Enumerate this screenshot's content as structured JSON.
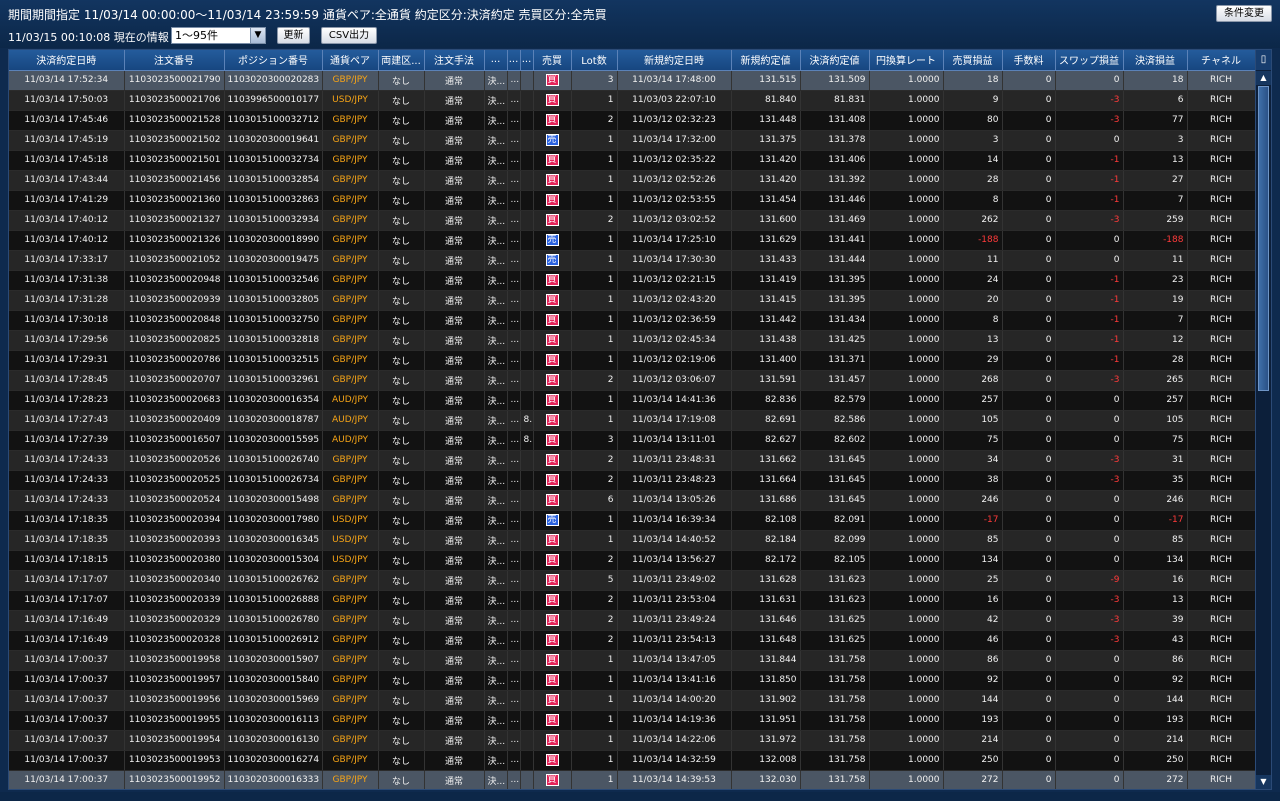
{
  "header": {
    "line1": "期間期間指定  11/03/14 00:00:00～11/03/14 23:59:59   通貨ペア:全通貨   約定区分:決済約定   売買区分:全売買",
    "line2": "11/03/15 00:10:08  現在の情報",
    "range_value": "1～95件",
    "update_label": "更新",
    "csv_label": "CSV出力",
    "condition_label": "条件変更"
  },
  "columns": [
    "決済約定日時",
    "注文番号",
    "ポジション番号",
    "通貨ペア",
    "両建区...",
    "注文手法",
    "...",
    "...",
    "...",
    "売買",
    "Lot数",
    "新規約定日時",
    "新規約定値",
    "決済約定値",
    "円換算レート",
    "売買損益",
    "手数料",
    "スワップ損益",
    "決済損益",
    "チャネル"
  ],
  "colors": {
    "buy": "#e4245a",
    "sell": "#2a62e0",
    "pair": "#f6a417",
    "negative": "#ff3a3a"
  },
  "rows": [
    [
      "11/03/14 17:52:34",
      "1103023500021790",
      "1103020300020283",
      "GBP/JPY",
      "なし",
      "通常",
      "決...",
      "...",
      "",
      "買",
      "3",
      "11/03/14 17:48:00",
      "131.515",
      "131.509",
      "1.0000",
      "18",
      "0",
      "0",
      "18",
      "RICH"
    ],
    [
      "11/03/14 17:50:03",
      "1103023500021706",
      "1103996500010177",
      "USD/JPY",
      "なし",
      "通常",
      "決...",
      "...",
      "",
      "買",
      "1",
      "11/03/03 22:07:10",
      "81.840",
      "81.831",
      "1.0000",
      "9",
      "0",
      "-3",
      "6",
      "RICH"
    ],
    [
      "11/03/14 17:45:46",
      "1103023500021528",
      "1103015100032712",
      "GBP/JPY",
      "なし",
      "通常",
      "決...",
      "...",
      "",
      "買",
      "2",
      "11/03/12 02:32:23",
      "131.448",
      "131.408",
      "1.0000",
      "80",
      "0",
      "-3",
      "77",
      "RICH"
    ],
    [
      "11/03/14 17:45:19",
      "1103023500021502",
      "1103020300019641",
      "GBP/JPY",
      "なし",
      "通常",
      "決...",
      "...",
      "",
      "売",
      "1",
      "11/03/14 17:32:00",
      "131.375",
      "131.378",
      "1.0000",
      "3",
      "0",
      "0",
      "3",
      "RICH"
    ],
    [
      "11/03/14 17:45:18",
      "1103023500021501",
      "1103015100032734",
      "GBP/JPY",
      "なし",
      "通常",
      "決...",
      "...",
      "",
      "買",
      "1",
      "11/03/12 02:35:22",
      "131.420",
      "131.406",
      "1.0000",
      "14",
      "0",
      "-1",
      "13",
      "RICH"
    ],
    [
      "11/03/14 17:43:44",
      "1103023500021456",
      "1103015100032854",
      "GBP/JPY",
      "なし",
      "通常",
      "決...",
      "...",
      "",
      "買",
      "1",
      "11/03/12 02:52:26",
      "131.420",
      "131.392",
      "1.0000",
      "28",
      "0",
      "-1",
      "27",
      "RICH"
    ],
    [
      "11/03/14 17:41:29",
      "1103023500021360",
      "1103015100032863",
      "GBP/JPY",
      "なし",
      "通常",
      "決...",
      "...",
      "",
      "買",
      "1",
      "11/03/12 02:53:55",
      "131.454",
      "131.446",
      "1.0000",
      "8",
      "0",
      "-1",
      "7",
      "RICH"
    ],
    [
      "11/03/14 17:40:12",
      "1103023500021327",
      "1103015100032934",
      "GBP/JPY",
      "なし",
      "通常",
      "決...",
      "...",
      "",
      "買",
      "2",
      "11/03/12 03:02:52",
      "131.600",
      "131.469",
      "1.0000",
      "262",
      "0",
      "-3",
      "259",
      "RICH"
    ],
    [
      "11/03/14 17:40:12",
      "1103023500021326",
      "1103020300018990",
      "GBP/JPY",
      "なし",
      "通常",
      "決...",
      "...",
      "",
      "売",
      "1",
      "11/03/14 17:25:10",
      "131.629",
      "131.441",
      "1.0000",
      "-188",
      "0",
      "0",
      "-188",
      "RICH"
    ],
    [
      "11/03/14 17:33:17",
      "1103023500021052",
      "1103020300019475",
      "GBP/JPY",
      "なし",
      "通常",
      "決...",
      "...",
      "",
      "売",
      "1",
      "11/03/14 17:30:30",
      "131.433",
      "131.444",
      "1.0000",
      "11",
      "0",
      "0",
      "11",
      "RICH"
    ],
    [
      "11/03/14 17:31:38",
      "1103023500020948",
      "1103015100032546",
      "GBP/JPY",
      "なし",
      "通常",
      "決...",
      "...",
      "",
      "買",
      "1",
      "11/03/12 02:21:15",
      "131.419",
      "131.395",
      "1.0000",
      "24",
      "0",
      "-1",
      "23",
      "RICH"
    ],
    [
      "11/03/14 17:31:28",
      "1103023500020939",
      "1103015100032805",
      "GBP/JPY",
      "なし",
      "通常",
      "決...",
      "...",
      "",
      "買",
      "1",
      "11/03/12 02:43:20",
      "131.415",
      "131.395",
      "1.0000",
      "20",
      "0",
      "-1",
      "19",
      "RICH"
    ],
    [
      "11/03/14 17:30:18",
      "1103023500020848",
      "1103015100032750",
      "GBP/JPY",
      "なし",
      "通常",
      "決...",
      "...",
      "",
      "買",
      "1",
      "11/03/12 02:36:59",
      "131.442",
      "131.434",
      "1.0000",
      "8",
      "0",
      "-1",
      "7",
      "RICH"
    ],
    [
      "11/03/14 17:29:56",
      "1103023500020825",
      "1103015100032818",
      "GBP/JPY",
      "なし",
      "通常",
      "決...",
      "...",
      "",
      "買",
      "1",
      "11/03/12 02:45:34",
      "131.438",
      "131.425",
      "1.0000",
      "13",
      "0",
      "-1",
      "12",
      "RICH"
    ],
    [
      "11/03/14 17:29:31",
      "1103023500020786",
      "1103015100032515",
      "GBP/JPY",
      "なし",
      "通常",
      "決...",
      "...",
      "",
      "買",
      "1",
      "11/03/12 02:19:06",
      "131.400",
      "131.371",
      "1.0000",
      "29",
      "0",
      "-1",
      "28",
      "RICH"
    ],
    [
      "11/03/14 17:28:45",
      "1103023500020707",
      "1103015100032961",
      "GBP/JPY",
      "なし",
      "通常",
      "決...",
      "...",
      "",
      "買",
      "2",
      "11/03/12 03:06:07",
      "131.591",
      "131.457",
      "1.0000",
      "268",
      "0",
      "-3",
      "265",
      "RICH"
    ],
    [
      "11/03/14 17:28:23",
      "1103023500020683",
      "1103020300016354",
      "AUD/JPY",
      "なし",
      "通常",
      "決...",
      "...",
      "",
      "買",
      "1",
      "11/03/14 14:41:36",
      "82.836",
      "82.579",
      "1.0000",
      "257",
      "0",
      "0",
      "257",
      "RICH"
    ],
    [
      "11/03/14 17:27:43",
      "1103023500020409",
      "1103020300018787",
      "AUD/JPY",
      "なし",
      "通常",
      "決...",
      "...",
      "8...",
      "買",
      "1",
      "11/03/14 17:19:08",
      "82.691",
      "82.586",
      "1.0000",
      "105",
      "0",
      "0",
      "105",
      "RICH"
    ],
    [
      "11/03/14 17:27:39",
      "1103023500016507",
      "1103020300015595",
      "AUD/JPY",
      "なし",
      "通常",
      "決...",
      "...",
      "8...",
      "買",
      "3",
      "11/03/14 13:11:01",
      "82.627",
      "82.602",
      "1.0000",
      "75",
      "0",
      "0",
      "75",
      "RICH"
    ],
    [
      "11/03/14 17:24:33",
      "1103023500020526",
      "1103015100026740",
      "GBP/JPY",
      "なし",
      "通常",
      "決...",
      "...",
      "",
      "買",
      "2",
      "11/03/11 23:48:31",
      "131.662",
      "131.645",
      "1.0000",
      "34",
      "0",
      "-3",
      "31",
      "RICH"
    ],
    [
      "11/03/14 17:24:33",
      "1103023500020525",
      "1103015100026734",
      "GBP/JPY",
      "なし",
      "通常",
      "決...",
      "...",
      "",
      "買",
      "2",
      "11/03/11 23:48:23",
      "131.664",
      "131.645",
      "1.0000",
      "38",
      "0",
      "-3",
      "35",
      "RICH"
    ],
    [
      "11/03/14 17:24:33",
      "1103023500020524",
      "1103020300015498",
      "GBP/JPY",
      "なし",
      "通常",
      "決...",
      "...",
      "",
      "買",
      "6",
      "11/03/14 13:05:26",
      "131.686",
      "131.645",
      "1.0000",
      "246",
      "0",
      "0",
      "246",
      "RICH"
    ],
    [
      "11/03/14 17:18:35",
      "1103023500020394",
      "1103020300017980",
      "USD/JPY",
      "なし",
      "通常",
      "決...",
      "...",
      "",
      "売",
      "1",
      "11/03/14 16:39:34",
      "82.108",
      "82.091",
      "1.0000",
      "-17",
      "0",
      "0",
      "-17",
      "RICH"
    ],
    [
      "11/03/14 17:18:35",
      "1103023500020393",
      "1103020300016345",
      "USD/JPY",
      "なし",
      "通常",
      "決...",
      "...",
      "",
      "買",
      "1",
      "11/03/14 14:40:52",
      "82.184",
      "82.099",
      "1.0000",
      "85",
      "0",
      "0",
      "85",
      "RICH"
    ],
    [
      "11/03/14 17:18:15",
      "1103023500020380",
      "1103020300015304",
      "USD/JPY",
      "なし",
      "通常",
      "決...",
      "...",
      "",
      "買",
      "2",
      "11/03/14 13:56:27",
      "82.172",
      "82.105",
      "1.0000",
      "134",
      "0",
      "0",
      "134",
      "RICH"
    ],
    [
      "11/03/14 17:17:07",
      "1103023500020340",
      "1103015100026762",
      "GBP/JPY",
      "なし",
      "通常",
      "決...",
      "...",
      "",
      "買",
      "5",
      "11/03/11 23:49:02",
      "131.628",
      "131.623",
      "1.0000",
      "25",
      "0",
      "-9",
      "16",
      "RICH"
    ],
    [
      "11/03/14 17:17:07",
      "1103023500020339",
      "1103015100026888",
      "GBP/JPY",
      "なし",
      "通常",
      "決...",
      "...",
      "",
      "買",
      "2",
      "11/03/11 23:53:04",
      "131.631",
      "131.623",
      "1.0000",
      "16",
      "0",
      "-3",
      "13",
      "RICH"
    ],
    [
      "11/03/14 17:16:49",
      "1103023500020329",
      "1103015100026780",
      "GBP/JPY",
      "なし",
      "通常",
      "決...",
      "...",
      "",
      "買",
      "2",
      "11/03/11 23:49:24",
      "131.646",
      "131.625",
      "1.0000",
      "42",
      "0",
      "-3",
      "39",
      "RICH"
    ],
    [
      "11/03/14 17:16:49",
      "1103023500020328",
      "1103015100026912",
      "GBP/JPY",
      "なし",
      "通常",
      "決...",
      "...",
      "",
      "買",
      "2",
      "11/03/11 23:54:13",
      "131.648",
      "131.625",
      "1.0000",
      "46",
      "0",
      "-3",
      "43",
      "RICH"
    ],
    [
      "11/03/14 17:00:37",
      "1103023500019958",
      "1103020300015907",
      "GBP/JPY",
      "なし",
      "通常",
      "決...",
      "...",
      "",
      "買",
      "1",
      "11/03/14 13:47:05",
      "131.844",
      "131.758",
      "1.0000",
      "86",
      "0",
      "0",
      "86",
      "RICH"
    ],
    [
      "11/03/14 17:00:37",
      "1103023500019957",
      "1103020300015840",
      "GBP/JPY",
      "なし",
      "通常",
      "決...",
      "...",
      "",
      "買",
      "1",
      "11/03/14 13:41:16",
      "131.850",
      "131.758",
      "1.0000",
      "92",
      "0",
      "0",
      "92",
      "RICH"
    ],
    [
      "11/03/14 17:00:37",
      "1103023500019956",
      "1103020300015969",
      "GBP/JPY",
      "なし",
      "通常",
      "決...",
      "...",
      "",
      "買",
      "1",
      "11/03/14 14:00:20",
      "131.902",
      "131.758",
      "1.0000",
      "144",
      "0",
      "0",
      "144",
      "RICH"
    ],
    [
      "11/03/14 17:00:37",
      "1103023500019955",
      "1103020300016113",
      "GBP/JPY",
      "なし",
      "通常",
      "決...",
      "...",
      "",
      "買",
      "1",
      "11/03/14 14:19:36",
      "131.951",
      "131.758",
      "1.0000",
      "193",
      "0",
      "0",
      "193",
      "RICH"
    ],
    [
      "11/03/14 17:00:37",
      "1103023500019954",
      "1103020300016130",
      "GBP/JPY",
      "なし",
      "通常",
      "決...",
      "...",
      "",
      "買",
      "1",
      "11/03/14 14:22:06",
      "131.972",
      "131.758",
      "1.0000",
      "214",
      "0",
      "0",
      "214",
      "RICH"
    ],
    [
      "11/03/14 17:00:37",
      "1103023500019953",
      "1103020300016274",
      "GBP/JPY",
      "なし",
      "通常",
      "決...",
      "...",
      "",
      "買",
      "1",
      "11/03/14 14:32:59",
      "132.008",
      "131.758",
      "1.0000",
      "250",
      "0",
      "0",
      "250",
      "RICH"
    ],
    [
      "11/03/14 17:00:37",
      "1103023500019952",
      "1103020300016333",
      "GBP/JPY",
      "なし",
      "通常",
      "決...",
      "...",
      "",
      "買",
      "1",
      "11/03/14 14:39:53",
      "132.030",
      "131.758",
      "1.0000",
      "272",
      "0",
      "0",
      "272",
      "RICH"
    ]
  ],
  "selected_rows": [
    0,
    35
  ],
  "scrollbar": {
    "corner_icon": "column-settings-icon",
    "up_icon": "▲",
    "down_icon": "▼"
  }
}
